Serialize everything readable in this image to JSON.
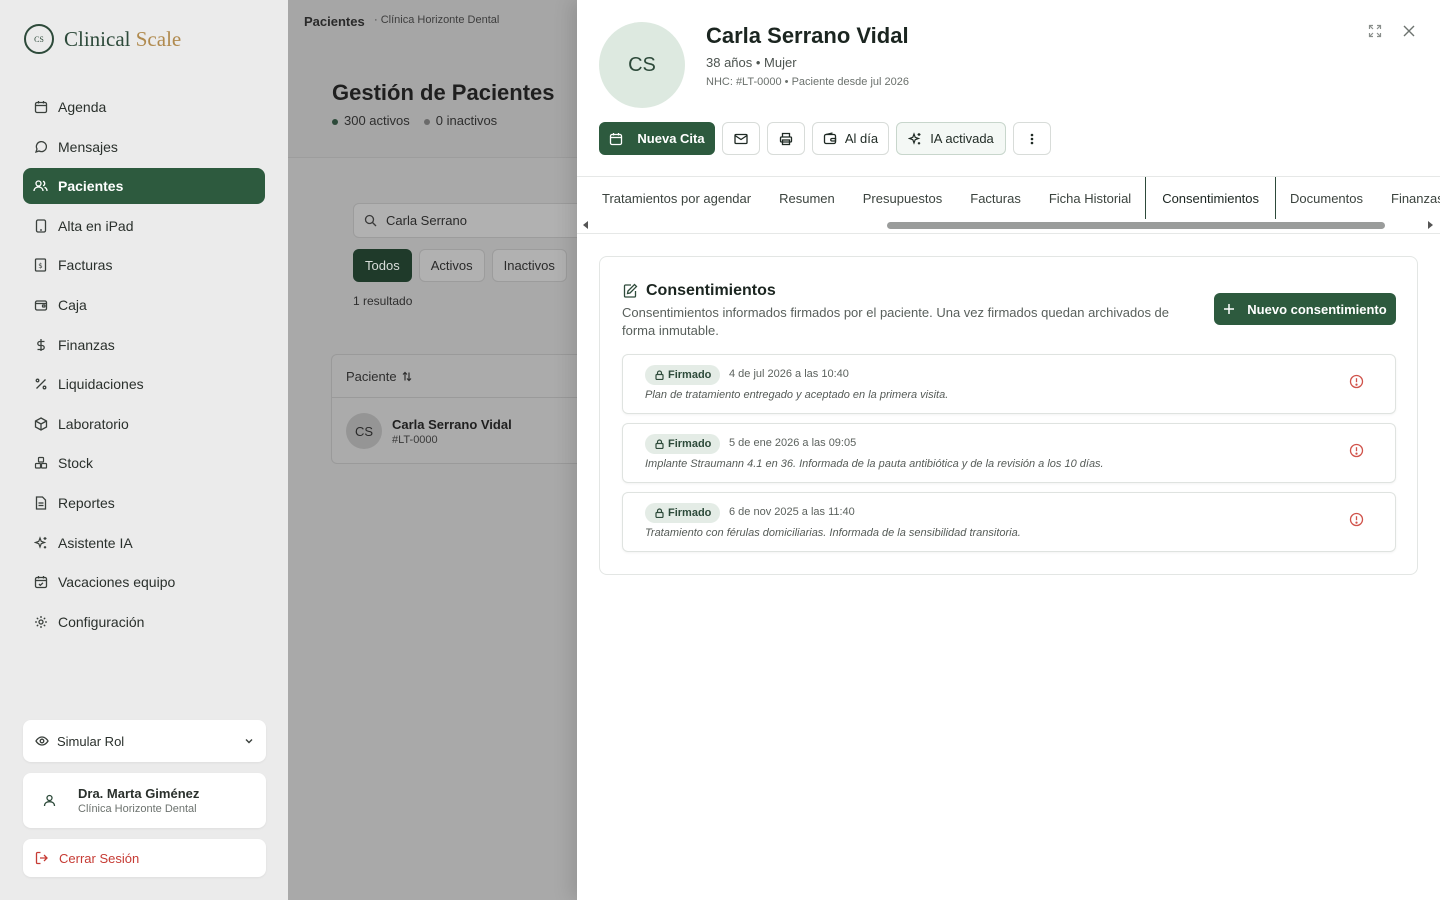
{
  "app": {
    "logo_mark": "CS",
    "logo_primary": "Clinical ",
    "logo_accent": "Scale",
    "brand_color": "#2d5a3e",
    "accent_color": "#b08a4e"
  },
  "sidebar": {
    "items": [
      {
        "label": "Agenda",
        "icon": "calendar-icon"
      },
      {
        "label": "Mensajes",
        "icon": "chat-icon"
      },
      {
        "label": "Pacientes",
        "icon": "users-icon",
        "active": true
      },
      {
        "label": "Alta en iPad",
        "icon": "tablet-icon"
      },
      {
        "label": "Facturas",
        "icon": "invoice-icon"
      },
      {
        "label": "Caja",
        "icon": "cash-register-icon"
      },
      {
        "label": "Finanzas",
        "icon": "dollar-icon"
      },
      {
        "label": "Liquidaciones",
        "icon": "percent-icon"
      },
      {
        "label": "Laboratorio",
        "icon": "box-icon"
      },
      {
        "label": "Stock",
        "icon": "boxes-icon"
      },
      {
        "label": "Reportes",
        "icon": "report-icon"
      },
      {
        "label": "Asistente IA",
        "icon": "sparkles-icon"
      },
      {
        "label": "Vacaciones equipo",
        "icon": "calendar-check-icon"
      },
      {
        "label": "Configuración",
        "icon": "gear-icon"
      }
    ],
    "simular_rol": "Simular Rol",
    "user": {
      "name": "Dra. Marta Giménez",
      "clinic": "Clínica Horizonte Dental"
    },
    "logout": "Cerrar Sesión"
  },
  "middle": {
    "breadcrumb": "Pacientes",
    "breadcrumb_sub": "· Clínica Horizonte Dental",
    "title": "Gestión de Pacientes",
    "stats": {
      "active": "300 activos",
      "inactive": "0 inactivos"
    },
    "search_value": "Carla Serrano",
    "filters": [
      {
        "label": "Todos",
        "active": true
      },
      {
        "label": "Activos"
      },
      {
        "label": "Inactivos"
      }
    ],
    "results": "1 resultado",
    "table": {
      "header": "Paciente",
      "rows": [
        {
          "initials": "CS",
          "name": "Carla Serrano Vidal",
          "id": "#LT-0000"
        }
      ]
    }
  },
  "patient": {
    "initials": "CS",
    "name": "Carla Serrano Vidal",
    "meta": "38 años • Mujer",
    "nhc": "NHC: #LT-0000 • Paciente desde jul 2026",
    "actions": {
      "new_appointment": "Nueva Cita",
      "status": "Al día",
      "ia": "IA activada"
    },
    "tabs": [
      {
        "label": "Tratamientos por agendar"
      },
      {
        "label": "Resumen"
      },
      {
        "label": "Presupuestos"
      },
      {
        "label": "Facturas"
      },
      {
        "label": "Ficha Historial"
      },
      {
        "label": "Consentimientos",
        "active": true
      },
      {
        "label": "Documentos"
      },
      {
        "label": "Finanzas"
      }
    ],
    "consents": {
      "title": "Consentimientos",
      "description": "Consentimientos informados firmados por el paciente. Una vez firmados quedan archivados de forma inmutable.",
      "new_button": "Nuevo consentimiento",
      "records": [
        {
          "status": "Firmado",
          "date": "4 de jul 2026 a las 10:40",
          "note": "Plan de tratamiento entregado y aceptado en la primera visita."
        },
        {
          "status": "Firmado",
          "date": "5 de ene 2026 a las 09:05",
          "note": "Implante Straumann 4.1 en 36. Informada de la pauta antibiótica y de la revisión a los 10 días."
        },
        {
          "status": "Firmado",
          "date": "6 de nov 2025 a las 11:40",
          "note": "Tratamiento con férulas domiciliarias. Informada de la sensibilidad transitoria."
        }
      ]
    }
  }
}
